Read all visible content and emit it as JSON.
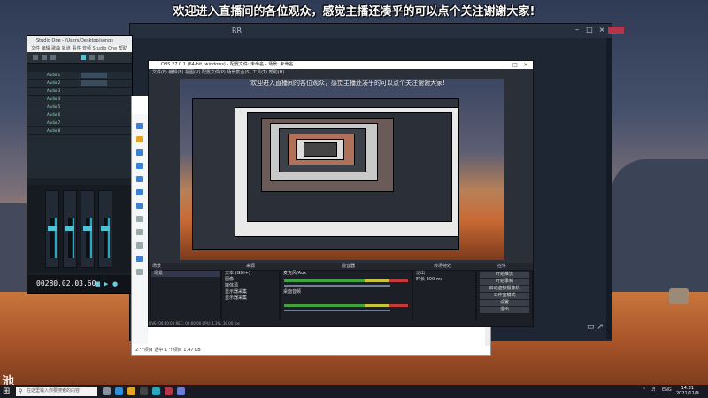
{
  "banner": {
    "text": "欢迎进入直播间的各位观众，感觉主播还凑乎的可以点个关注谢谢大家!"
  },
  "back_window": {
    "title": "RR"
  },
  "daw": {
    "title": "Studio One - /Users/Desktop/songs",
    "menu": "文件  编辑  歌曲  轨道  事件  音频  Studio One  帮助",
    "time": "00280.02.03.60",
    "tracks": [
      "Audio 1",
      "Audio 2",
      "Audio 3",
      "Audio 4",
      "Audio 5",
      "Audio 6",
      "Audio 7",
      "Audio 8"
    ]
  },
  "explorer": {
    "status": "2 个项目   选中 1 个项目  1.47 KB"
  },
  "obs": {
    "title": "OBS 27.0.1 (64-bit, windows) - 配置文件: 未命名 - 场景: 未命名",
    "menu": "文件(F)  编辑(E)  视图(V)  配置文件(P)  场景集合(S)  工具(T)  帮助(H)",
    "preview_banner": "欢迎进入直播间的各位观众，感觉主播还凑乎的可以点个关注谢谢大家!",
    "panels": {
      "scenes_hdr": "场景",
      "sources_hdr": "来源",
      "mixer_hdr": "混音器",
      "transition_hdr": "转场特效",
      "controls_hdr": "控件",
      "scene_items": [
        "场景"
      ],
      "source_items": [
        "文本 (GDI+)",
        "图像",
        "媒体源",
        "显示器采集",
        "显示器采集"
      ],
      "mixer_items": [
        "麦克风/Aux",
        "桌面音频"
      ],
      "transition_items": [
        "淡出",
        "时长  300 ms"
      ],
      "controls": [
        "开始推流",
        "开始录制",
        "启动虚拟摄像机",
        "工作室模式",
        "设置",
        "退出"
      ]
    },
    "status": "LIVE: 00:00:00    REC: 00:00:00    CPU: 1.3%, 30.00 fps"
  },
  "taskbar": {
    "search_placeholder": "在这里输入你要搜索的内容",
    "tray_lang": "ENG",
    "clock_time": "14:31",
    "clock_date": "2021/11/9"
  },
  "colors": {
    "accent": "#3b82d6",
    "obs_bg": "#2b2f37",
    "daw_meter": "#2aa6bf"
  },
  "icons": [
    "windows-start-icon",
    "search-icon",
    "close-icon",
    "minimize-icon",
    "maximize-icon",
    "play-icon",
    "stop-icon",
    "record-icon",
    "gear-icon"
  ]
}
